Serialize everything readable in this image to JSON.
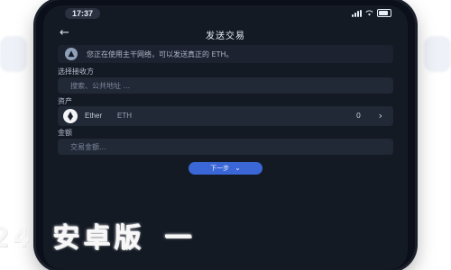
{
  "status_bar": {
    "time": "17:37"
  },
  "nav": {
    "title": "发送交易"
  },
  "notice": {
    "text": "您正在使用主干网络，可以发送真正的 ETH。"
  },
  "recipient": {
    "label": "选择接收方",
    "placeholder": "搜索、公共地址 ..."
  },
  "asset": {
    "label": "资产",
    "name": "Ether",
    "symbol": "ETH",
    "balance": "0"
  },
  "amount": {
    "label": "金额",
    "placeholder": "交易金额..."
  },
  "submit": {
    "label": "下一步"
  },
  "overlay": {
    "text": "24 安卓版 一"
  },
  "colors": {
    "accent": "#3b66d6",
    "screen_bg": "#141a24",
    "field_bg": "#212836"
  },
  "icons": [
    "back-arrow-icon",
    "warning-icon",
    "eth-icon",
    "chevron-right-icon",
    "chevron-down-icon",
    "signal-icon",
    "wifi-icon",
    "battery-icon"
  ]
}
